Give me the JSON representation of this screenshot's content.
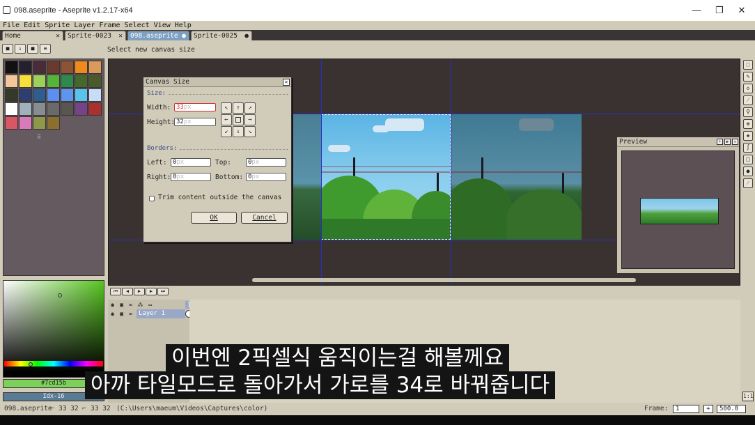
{
  "window": {
    "title": "098.aseprite - Aseprite v1.2.17-x64",
    "minimize": "—",
    "maximize": "❐",
    "close": "✕"
  },
  "menu": [
    "File",
    "Edit",
    "Sprite",
    "Layer",
    "Frame",
    "Select",
    "View",
    "Help"
  ],
  "tabs": [
    {
      "label": "Home",
      "close": "✕"
    },
    {
      "label": "Sprite-0023",
      "close": "✕"
    },
    {
      "label": "098.aseprite",
      "close": "●"
    },
    {
      "label": "Sprite-0025",
      "close": "●"
    }
  ],
  "status_hint": "Select new canvas size",
  "palette": [
    "#111111",
    "#23212e",
    "#4a2b3a",
    "#6b3a2e",
    "#8c5434",
    "#f08a1c",
    "#d99a5c",
    "#f3c69c",
    "#f7de3a",
    "#9cd05a",
    "#57b43a",
    "#2d8a4f",
    "#45682b",
    "#4b5a2c",
    "#35392a",
    "#2c3f6e",
    "#2e5d90",
    "#5d8ff0",
    "#5e95ee",
    "#58c4ee",
    "#c6dcf7",
    "#ffffff",
    "#9fb1bb",
    "#868e93",
    "#6a6a6a",
    "#595652",
    "#76428a",
    "#ab3030",
    "#d95763",
    "#d77bba",
    "#8f974a",
    "#8a6f30"
  ],
  "palette_more": "⠿",
  "color": {
    "fg_hex": "#7cd15b",
    "fg_label": "#7cd15b",
    "bg_label": "Idx-16"
  },
  "dialog": {
    "title": "Canvas Size",
    "size_section": "Size:",
    "width_label": "Width:",
    "width_value": "33",
    "width_unit": "px",
    "height_label": "Height:",
    "height_value": "32",
    "height_unit": "px",
    "borders_section": "Borders:",
    "left_label": "Left:",
    "left_value": "0",
    "left_unit": "px",
    "top_label": "Top:",
    "top_value": "0",
    "top_unit": "px",
    "right_label": "Right:",
    "right_value": "0",
    "right_unit": "px",
    "bottom_label": "Bottom:",
    "bottom_value": "0",
    "bottom_unit": "px",
    "trim_label": "Trim content outside the canvas",
    "ok": "OK",
    "cancel": "Cancel",
    "anchors": [
      "↖",
      "↑",
      "↗",
      "←",
      "",
      "→",
      "↙",
      "↓",
      "↘"
    ]
  },
  "preview": {
    "title": "Preview"
  },
  "timeline": {
    "buttons": [
      "⏮",
      "◀",
      "▶",
      "▶",
      "⏭"
    ],
    "frame_number": "1",
    "layer_name": "Layer 1"
  },
  "subtitles": {
    "line1": "이번엔 2픽셀식 움직이는걸 해볼께요",
    "line2": "아까 타일모드로 돌아가서 가로를 34로 바꿔줍니다"
  },
  "statusbar": {
    "file": "098.aseprite",
    "pos1": "33 32",
    "pos2": "33 32",
    "path": "(C:\\Users\\maeum\\Videos\\Captures\\color)",
    "frame_label": "Frame:",
    "frame_value": "1",
    "zoom": "500.0",
    "ratio": "1:1"
  }
}
